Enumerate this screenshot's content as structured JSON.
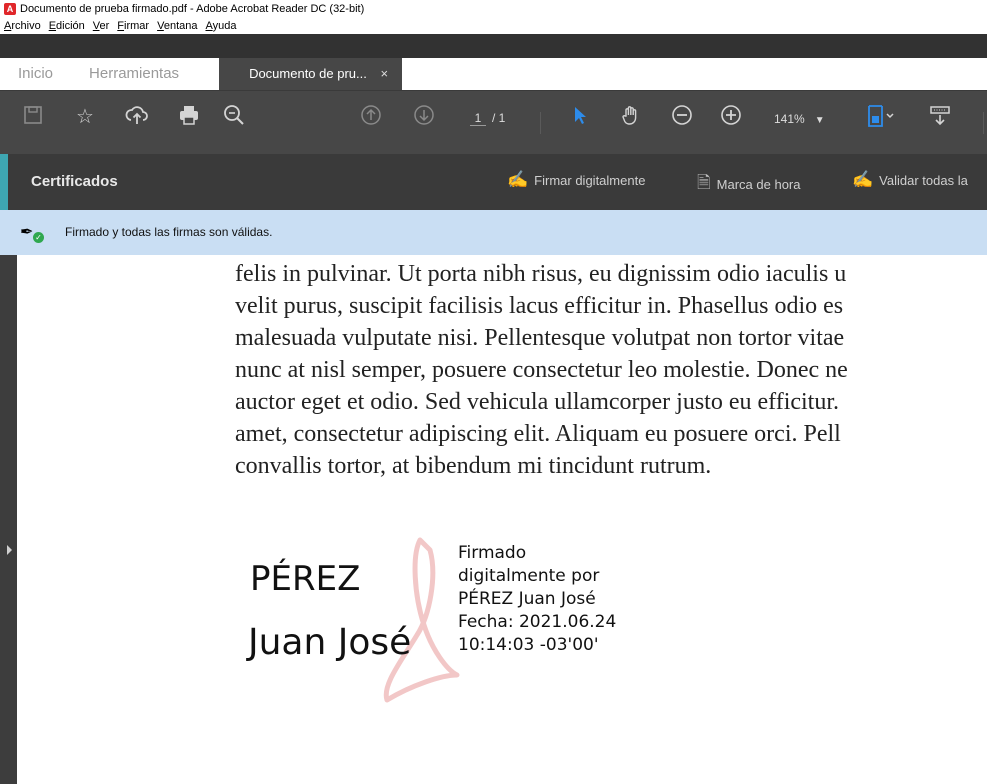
{
  "window": {
    "title": "Documento de prueba firmado.pdf - Adobe Acrobat Reader DC (32-bit)",
    "app_icon": "acrobat-icon"
  },
  "menu": [
    "Archivo",
    "Edición",
    "Ver",
    "Firmar",
    "Ventana",
    "Ayuda"
  ],
  "tabs": {
    "home": "Inicio",
    "tools": "Herramientas",
    "document": "Documento de pru...",
    "close": "×"
  },
  "toolbar": {
    "page_current": "1",
    "page_total": "/ 1",
    "zoom": "141%",
    "icons": [
      "save-icon",
      "bookmark-star-icon",
      "upload-cloud-icon",
      "print-icon",
      "search-zoom-icon",
      "page-up-icon",
      "page-down-icon",
      "select-cursor-icon",
      "hand-icon",
      "zoom-out-icon",
      "zoom-in-icon",
      "fit-page-icon",
      "scroll-mode-icon"
    ]
  },
  "certificates": {
    "title": "Certificados",
    "actions": {
      "sign": "Firmar digitalmente",
      "timestamp": "Marca de hora",
      "validate": "Validar todas la"
    },
    "accent_color": "#3ea7b2"
  },
  "info": {
    "message": "Firmado y todas las firmas son válidas.",
    "status_color": "#2fa84f"
  },
  "document": {
    "lines": [
      "felis in pulvinar. Ut porta nibh risus, eu dignissim odio iaculis u",
      "velit purus, suscipit facilisis lacus efficitur in. Phasellus odio es",
      "malesuada vulputate nisi. Pellentesque volutpat non tortor vitae",
      "nunc at nisl semper, posuere consectetur leo molestie. Donec ne",
      "auctor eget et odio. Sed vehicula ullamcorper justo eu efficitur.",
      "amet, consectetur adipiscing elit. Aliquam eu posuere orci. Pell",
      "convallis tortor, at bibendum mi tincidunt rutrum."
    ],
    "signature": {
      "surname": "PÉREZ",
      "given_name": "Juan José",
      "details": [
        "Firmado",
        "digitalmente por",
        "PÉREZ Juan José",
        "Fecha: 2021.06.24",
        "10:14:03 -03'00'"
      ]
    }
  }
}
